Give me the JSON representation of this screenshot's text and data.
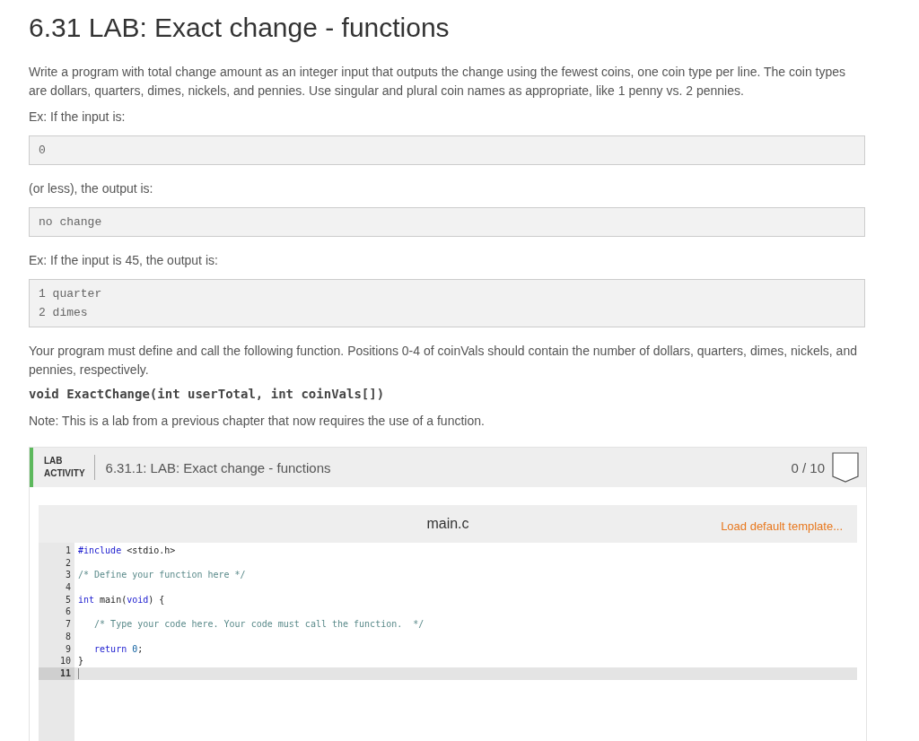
{
  "title": "6.31 LAB: Exact change - functions",
  "intro": "Write a program with total change amount as an integer input that outputs the change using the fewest coins, one coin type per line. The coin types are dollars, quarters, dimes, nickels, and pennies. Use singular and plural coin names as appropriate, like 1 penny vs. 2 pennies.",
  "blocks": [
    {
      "kind": "text",
      "text": "Ex: If the input is:"
    },
    {
      "kind": "sample",
      "lines": [
        "0"
      ]
    },
    {
      "kind": "text",
      "text": "(or less), the output is:"
    },
    {
      "kind": "sample",
      "lines": [
        "no change"
      ]
    },
    {
      "kind": "text",
      "text": "Ex: If the input is 45, the output is:"
    },
    {
      "kind": "sample",
      "lines": [
        "1 quarter",
        "2 dimes"
      ]
    },
    {
      "kind": "text",
      "text": "Your program must define and call the following function. Positions 0-4 of coinVals should contain the number of dollars, quarters, dimes, nickels, and pennies, respectively."
    },
    {
      "kind": "signature",
      "text": "void ExactChange(int userTotal, int coinVals[])"
    },
    {
      "kind": "text",
      "text": "Note: This is a lab from a previous chapter that now requires the use of a function."
    }
  ],
  "lab": {
    "badge_line_1": "LAB",
    "badge_line_2": "ACTIVITY",
    "title": "6.31.1: LAB: Exact change - functions",
    "score": "0 / 10",
    "editor": {
      "filename": "main.c",
      "load_template": "Load default template...",
      "lines": [
        {
          "number": "1",
          "current": false,
          "tokens": [
            {
              "kind": "keyword",
              "text": "#include"
            },
            {
              "kind": "plain",
              "text": " <stdio.h>"
            }
          ]
        },
        {
          "number": "2",
          "current": false
        },
        {
          "number": "3",
          "current": false,
          "tokens": [
            {
              "kind": "comment",
              "text": "/* Define your function here */"
            }
          ]
        },
        {
          "number": "4",
          "current": false
        },
        {
          "number": "5",
          "current": false,
          "tokens": [
            {
              "kind": "keyword",
              "text": "int"
            },
            {
              "kind": "plain",
              "text": " main("
            },
            {
              "kind": "keyword",
              "text": "void"
            },
            {
              "kind": "plain",
              "text": ") {"
            }
          ]
        },
        {
          "number": "6",
          "current": false
        },
        {
          "number": "7",
          "current": false,
          "tokens": [
            {
              "kind": "comment",
              "text": "   /* Type your code here. Your code must call the function.  */"
            }
          ]
        },
        {
          "number": "8",
          "current": false
        },
        {
          "number": "9",
          "current": false,
          "tokens": [
            {
              "kind": "keyword",
              "text": "   return"
            },
            {
              "kind": "number",
              "text": " 0"
            },
            {
              "kind": "plain",
              "text": ";"
            }
          ]
        },
        {
          "number": "10",
          "current": false,
          "tokens": [
            {
              "kind": "plain",
              "text": "}"
            }
          ]
        },
        {
          "number": "11",
          "current": true
        }
      ]
    }
  }
}
